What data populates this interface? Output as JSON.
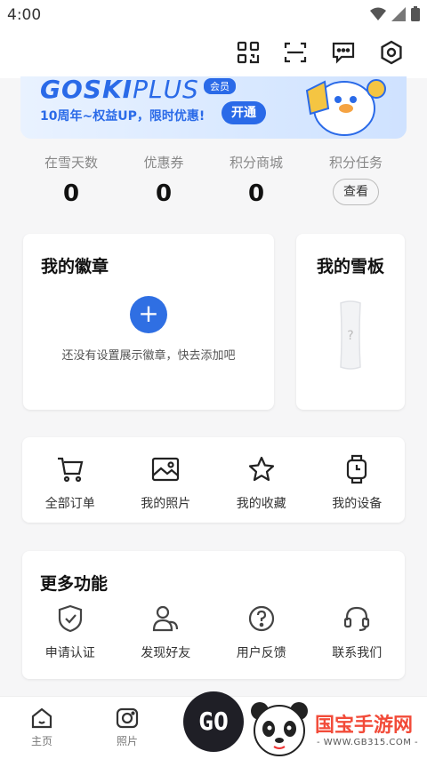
{
  "status_bar": {
    "time": "4:00"
  },
  "toolbar": {
    "icons": [
      "qr-code-icon",
      "scan-icon",
      "message-icon",
      "settings-icon"
    ]
  },
  "banner": {
    "logo": "GOSKI",
    "logo_suffix": "PLUS",
    "member_tag": "会员",
    "promo": "10周年~权益UP，限时优惠!",
    "open_button": "开通"
  },
  "stats": [
    {
      "label": "在雪天数",
      "value": "0"
    },
    {
      "label": "优惠券",
      "value": "0"
    },
    {
      "label": "积分商城",
      "value": "0"
    },
    {
      "label": "积分任务",
      "button": "查看"
    }
  ],
  "badges": {
    "title": "我的徽章",
    "add_symbol": "+",
    "hint": "还没有设置展示徽章，快去添加吧"
  },
  "snowboard": {
    "title": "我的雪板"
  },
  "quick_links": [
    {
      "label": "全部订单",
      "icon": "cart-icon"
    },
    {
      "label": "我的照片",
      "icon": "photo-icon"
    },
    {
      "label": "我的收藏",
      "icon": "star-icon"
    },
    {
      "label": "我的设备",
      "icon": "watch-icon"
    }
  ],
  "more": {
    "title": "更多功能",
    "items": [
      {
        "label": "申请认证",
        "icon": "shield-check-icon"
      },
      {
        "label": "发现好友",
        "icon": "friends-icon"
      },
      {
        "label": "用户反馈",
        "icon": "help-icon"
      },
      {
        "label": "联系我们",
        "icon": "headset-icon"
      }
    ]
  },
  "bottom_nav": {
    "home": "主页",
    "photos": "照片",
    "go": "GO"
  },
  "watermark": {
    "name": "国宝手游网",
    "url": "- WWW.GB315.COM -"
  },
  "colors": {
    "accent": "#2f6fe3",
    "banner_bg": "#d8e8ff"
  }
}
